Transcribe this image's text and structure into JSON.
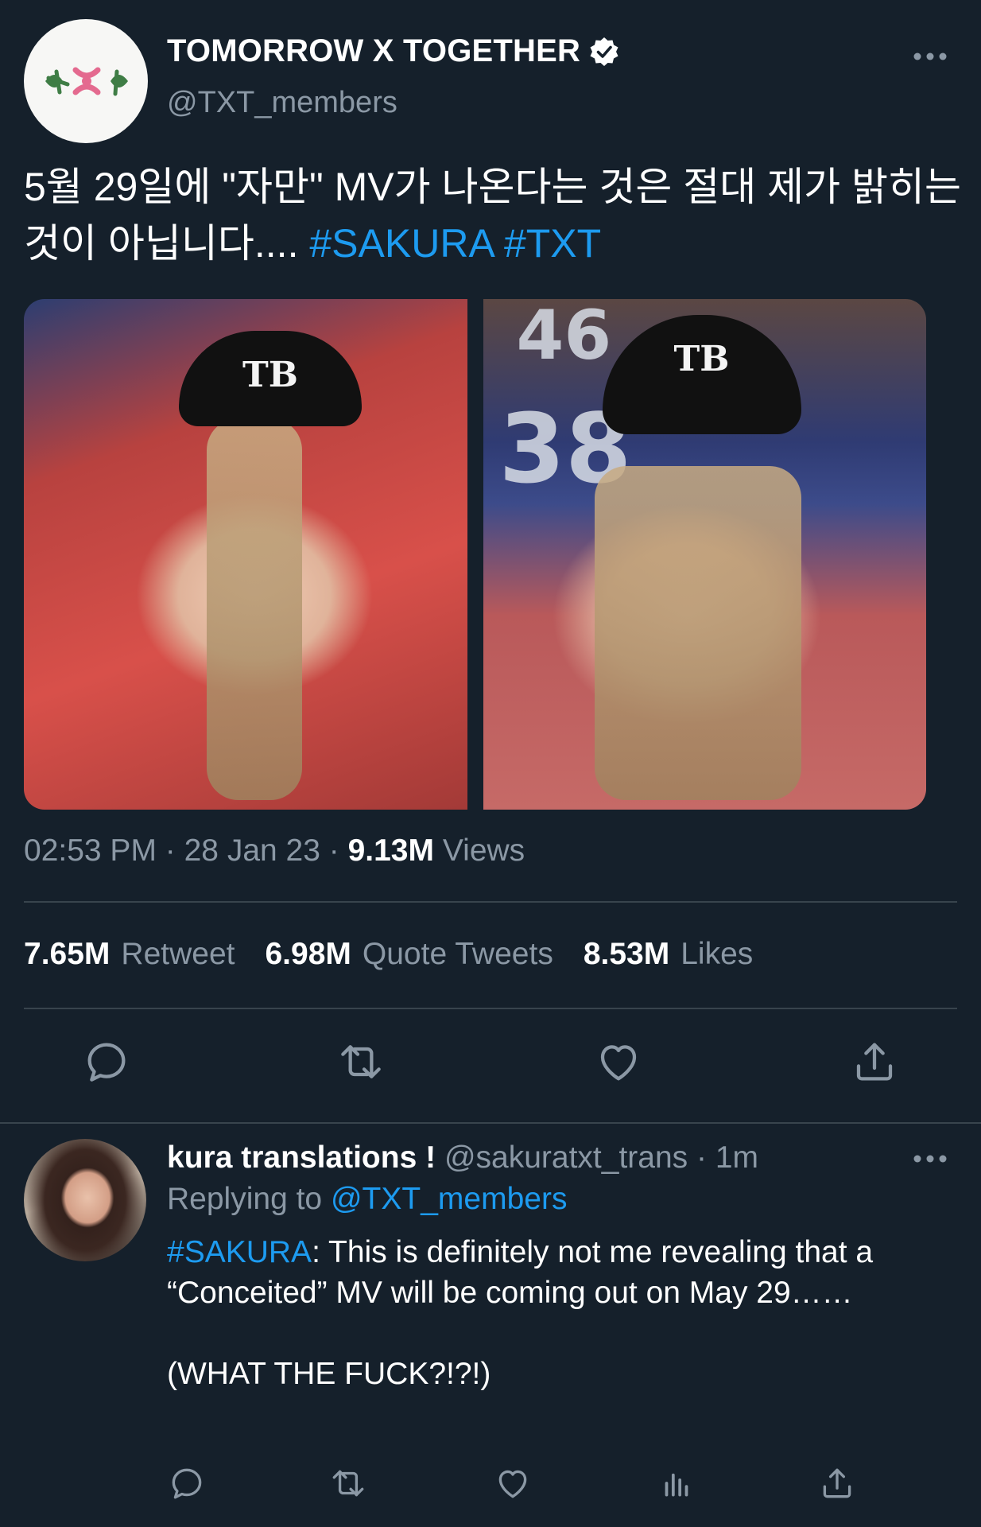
{
  "tweet": {
    "author": {
      "name": "TOMORROW X TOGETHER",
      "handle": "@TXT_members",
      "avatar_logo": "txt-flower-logo"
    },
    "text_main": "5월 29일에 \"자만\" MV가 나온다는 것은 절대 제가 밝히는 것이 아닙니다....",
    "hashtag_1": "#SAKURA",
    "hashtag_2": "#TXT",
    "photos": [
      {
        "alt": "woman in black cap with TB logo, leaning against red wall",
        "cap_logo": "TB"
      },
      {
        "alt": "woman in black cap with TB logo, seated near stadium seats",
        "cap_logo": "TB",
        "background_numbers": [
          "46",
          "38"
        ]
      }
    ],
    "time": "02:53 PM",
    "date": "28 Jan 23",
    "views_count": "9.13M",
    "views_label": "Views",
    "stats": [
      {
        "count": "7.65M",
        "label": "Retweet"
      },
      {
        "count": "6.98M",
        "label": "Quote Tweets"
      },
      {
        "count": "8.53M",
        "label": "Likes"
      }
    ],
    "actions": [
      "reply-icon",
      "retweet-icon",
      "like-icon",
      "share-icon"
    ]
  },
  "reply": {
    "name": "kura translations !",
    "handle": "@sakuratxt_trans",
    "age": "1m",
    "replying_to_label": "Replying to",
    "replying_to_mention": "@TXT_members",
    "hashtag": "#SAKURA",
    "line1_rest": ": This is definitely not me revealing that a “Conceited” MV will be coming out on May 29……",
    "line2": "(WHAT THE FUCK?!?!)",
    "actions": [
      "reply-icon",
      "retweet-icon",
      "like-icon",
      "analytics-icon",
      "share-icon"
    ]
  },
  "colors": {
    "background": "#15202b",
    "accent": "#1d9bf0",
    "secondary_text": "#8b98a5",
    "divider": "#38444d"
  }
}
